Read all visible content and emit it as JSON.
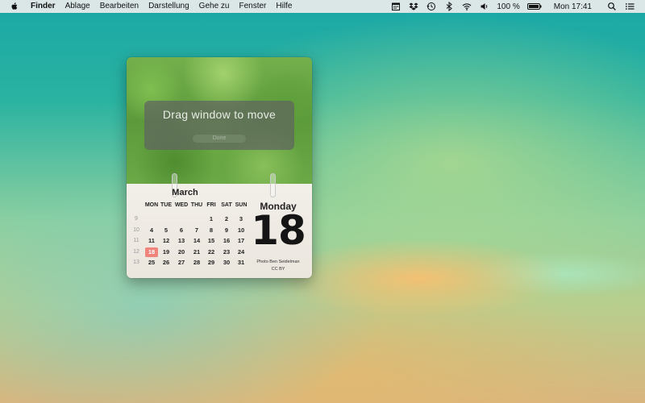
{
  "menubar": {
    "app_name": "Finder",
    "menus": [
      "Ablage",
      "Bearbeiten",
      "Darstellung",
      "Gehe zu",
      "Fenster",
      "Hilfe"
    ],
    "status_icons": [
      "calendar-icon",
      "dropbox-icon",
      "time-machine-icon",
      "bluetooth-icon",
      "wifi-icon",
      "volume-icon"
    ],
    "battery_percent": "100 %",
    "clock": "Mon 17:41",
    "right_icons": [
      "search-icon",
      "notification-center-icon"
    ]
  },
  "widget": {
    "overlay_text": "Drag window to move",
    "done_label": "Done",
    "month": "March",
    "weekdays": [
      "MON",
      "TUE",
      "WED",
      "THU",
      "FRI",
      "SAT",
      "SUN"
    ],
    "weeks": [
      {
        "number": "9",
        "days": [
          "",
          "",
          "",
          "",
          "1",
          "2",
          "3"
        ]
      },
      {
        "number": "10",
        "days": [
          "4",
          "5",
          "6",
          "7",
          "8",
          "9",
          "10"
        ]
      },
      {
        "number": "11",
        "days": [
          "11",
          "12",
          "13",
          "14",
          "15",
          "16",
          "17"
        ]
      },
      {
        "number": "12",
        "days": [
          "18",
          "19",
          "20",
          "21",
          "22",
          "23",
          "24"
        ]
      },
      {
        "number": "13",
        "days": [
          "25",
          "26",
          "27",
          "28",
          "29",
          "30",
          "31"
        ]
      }
    ],
    "today": "18",
    "weekday_name": "Monday",
    "day_number": "18",
    "credit_line1": "Photo Ben Seidelman",
    "credit_line2": "CC BY",
    "today_color": "#f0837a"
  }
}
